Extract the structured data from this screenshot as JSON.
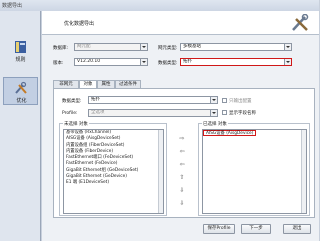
{
  "window": {
    "title": "数据导出"
  },
  "nav": [
    {
      "label": "规则",
      "icon": "book-icon"
    },
    {
      "label": "优化",
      "icon": "tools-icon"
    }
  ],
  "header": {
    "title": "优化数据导出",
    "icon": "wrench-screwdriver-icon"
  },
  "form": {
    "database_label": "数据库:",
    "database_value": "网元配",
    "network_type_label": "网元类型:",
    "network_type_value": "多模基站",
    "version_label": "版本:",
    "version_value": "V12.20.10",
    "data_type_label": "数据类型:",
    "data_type_value": "拓扑"
  },
  "tabs": [
    "非网元",
    "对象",
    "属性",
    "过滤条件"
  ],
  "panel": {
    "datatype_label": "数据类型:",
    "datatype_value": "拓扑",
    "profile_label": "Profile:",
    "profile_value": "全选项",
    "checkbox1": "只输出配置",
    "checkbox2": "显示字段名称",
    "left_group_title": "未选择 对象",
    "right_group_title": "已选择 对象",
    "left_items": [
      "基带设备 (RxChannel)",
      "AISG设备 (AisgDeviceSet)",
      "内置设备组 (FiberDeviceSet)",
      "内置设备 (FiberDevice)",
      "FastEthernet端口 (FeDeviceSet)",
      "FastEthernet (FeDevice)",
      "GigaBit Ethernet组 (GeDeviceSet)",
      "GigaBit Ethernet (GeDevice)",
      "E1 端 (E1DeviceSet)"
    ],
    "right_items": [
      "AISG设备 (AisgDevice)"
    ]
  },
  "buttons": {
    "save_profile": "保存Profile",
    "next": "下一步",
    "exit": "退出"
  }
}
